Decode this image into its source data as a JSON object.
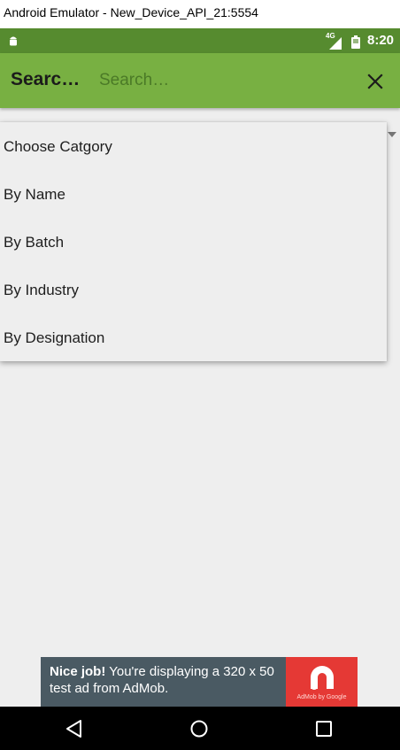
{
  "window": {
    "title": "Android Emulator - New_Device_API_21:5554"
  },
  "status_bar": {
    "network_type": "4G",
    "time": "8:20",
    "colors": {
      "background": "#568b2f"
    }
  },
  "app_bar": {
    "title": "Searc…",
    "search_placeholder": "Search…",
    "close_icon": "close-icon",
    "colors": {
      "background": "#78b042"
    }
  },
  "dropdown": {
    "items": [
      {
        "label": "Choose Catgory"
      },
      {
        "label": "By Name"
      },
      {
        "label": "By Batch"
      },
      {
        "label": "By Industry"
      },
      {
        "label": "By Designation"
      }
    ]
  },
  "ad_banner": {
    "headline": "Nice job!",
    "body": " You're displaying a 320 x 50 test ad from AdMob.",
    "brand_label": "AdMob by Google",
    "colors": {
      "background": "#4a5a63",
      "logo_background": "#e53935"
    }
  },
  "nav_bar": {
    "icons": [
      "back-icon",
      "home-icon",
      "recents-icon"
    ]
  }
}
